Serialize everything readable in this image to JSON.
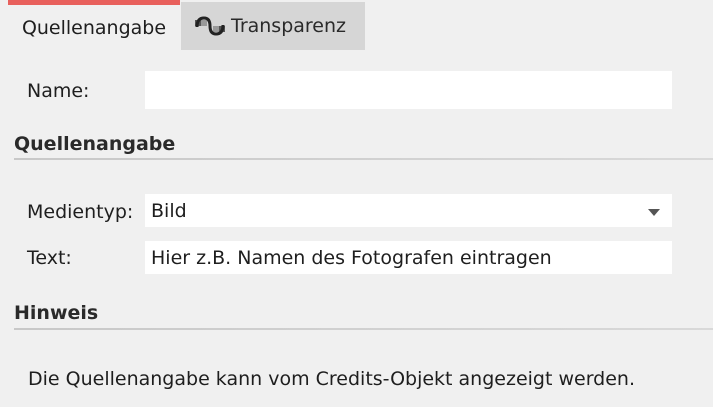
{
  "tabs": {
    "active_label": "Quellenangabe",
    "inactive_label": "Transparenz",
    "accent_color": "#e8605c"
  },
  "name": {
    "label": "Name:",
    "value": ""
  },
  "source_section": {
    "title": "Quellenangabe",
    "media_type_label": "Medientyp:",
    "media_type_value": "Bild",
    "text_label": "Text:",
    "text_value": "Hier z.B. Namen des Fotografen eintragen"
  },
  "hint_section": {
    "title": "Hinweis",
    "text": "Die Quellenangabe kann vom Credits-Objekt angezeigt werden."
  }
}
